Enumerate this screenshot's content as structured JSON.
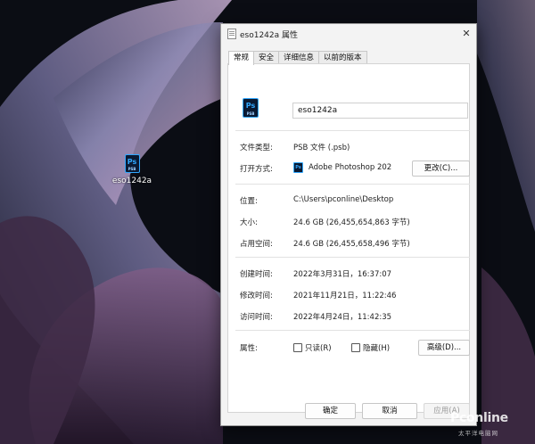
{
  "desktop": {
    "icon": {
      "icon_name": "photoshop-psb-icon",
      "icon_text": "Ps",
      "icon_sub": "PSB",
      "label": "eso1242a"
    },
    "wallpaper_colors": [
      "#0b0d14",
      "#3a3a5e",
      "#7c7aa6",
      "#a38fb6",
      "#4d2c4a"
    ]
  },
  "dialog": {
    "title": "eso1242a 属性",
    "close_glyph": "✕",
    "tabs": [
      {
        "label": "常规",
        "active": true
      },
      {
        "label": "安全",
        "active": false
      },
      {
        "label": "详细信息",
        "active": false
      },
      {
        "label": "以前的版本",
        "active": false
      }
    ],
    "file_icon": {
      "icon_name": "photoshop-psb-icon",
      "text": "Ps",
      "sub": "PSB"
    },
    "filename": "eso1242a",
    "rows": {
      "type": {
        "label": "文件类型:",
        "value": "PSB 文件 (.psb)"
      },
      "open_with": {
        "label": "打开方式:",
        "app_icon": "Ps",
        "value": "Adobe Photoshop 202",
        "button": "更改(C)..."
      },
      "location": {
        "label": "位置:",
        "value": "C:\\Users\\pconline\\Desktop"
      },
      "size": {
        "label": "大小:",
        "value": "24.6 GB (26,455,654,863 字节)"
      },
      "size_on_disk": {
        "label": "占用空间:",
        "value": "24.6 GB (26,455,658,496 字节)"
      },
      "created": {
        "label": "创建时间:",
        "value": "2022年3月31日，16:37:07"
      },
      "modified": {
        "label": "修改时间:",
        "value": "2021年11月21日，11:22:46"
      },
      "accessed": {
        "label": "访问时间:",
        "value": "2022年4月24日，11:42:35"
      }
    },
    "attributes": {
      "label": "属性:",
      "readonly": {
        "label": "只读(R)",
        "checked": false
      },
      "hidden": {
        "label": "隐藏(H)",
        "checked": false
      },
      "advanced_button": "高级(D)..."
    },
    "footer": {
      "ok": "确定",
      "cancel": "取消",
      "apply": "应用(A)"
    }
  },
  "watermark": {
    "brand": "Pconline",
    "sub": "太平洋电脑网"
  },
  "colors": {
    "ps_blue": "#31a8ff",
    "ps_dark": "#0a1a33",
    "dialog_bg": "#f3f3f3"
  }
}
